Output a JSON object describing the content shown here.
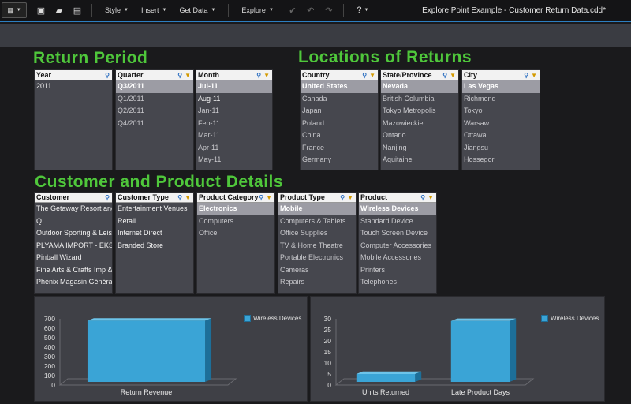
{
  "toolbar": {
    "menus": [
      "Style",
      "Insert",
      "Get Data",
      "Explore"
    ],
    "title": "Explore Point Example - Customer Return Data.cdd*"
  },
  "sections": {
    "return_period": "Return Period",
    "locations": "Locations of Returns",
    "details": "Customer and Product Details"
  },
  "listboxes": {
    "year": {
      "title": "Year",
      "items": [
        "2011"
      ]
    },
    "quarter": {
      "title": "Quarter",
      "items": [
        "Q3/2011",
        "Q1/2011",
        "Q2/2011",
        "Q4/2011"
      ]
    },
    "month": {
      "title": "Month",
      "items": [
        "Jul-11",
        "Aug-11",
        "Jan-11",
        "Feb-11",
        "Mar-11",
        "Apr-11",
        "May-11"
      ]
    },
    "country": {
      "title": "Country",
      "items": [
        "United States",
        "Canada",
        "Japan",
        "Poland",
        "China",
        "France",
        "Germany"
      ]
    },
    "state": {
      "title": "State/Province",
      "items": [
        "Nevada",
        "British Columbia",
        "Tokyo Metropolis",
        "Mazowieckie",
        "Ontario",
        "Nanjing",
        "Aquitaine"
      ]
    },
    "city": {
      "title": "City",
      "items": [
        "Las Vegas",
        "Richmond",
        "Tokyo",
        "Warsaw",
        "Ottawa",
        "Jiangsu",
        "Hossegor"
      ]
    },
    "customer": {
      "title": "Customer",
      "items": [
        "The Getaway Resort and",
        "Q",
        "Outdoor Sporting & Leis",
        "PLYAMA IMPORT - EKSP",
        "Pinball Wizard",
        "Fine Arts & Crafts Imp &",
        "Phénix Magasin Général"
      ]
    },
    "customer_type": {
      "title": "Customer Type",
      "items": [
        "Entertainment Venues",
        "Retail",
        "Internet Direct",
        "Branded Store"
      ]
    },
    "product_category": {
      "title": "Product Category",
      "items": [
        "Electronics",
        "Computers",
        "Office"
      ]
    },
    "product_type": {
      "title": "Product Type",
      "items": [
        "Mobile",
        "Computers & Tablets",
        "Office Supplies",
        "TV & Home Theatre",
        "Portable Electronics",
        "Cameras",
        "Repairs"
      ]
    },
    "product": {
      "title": "Product",
      "items": [
        "Wireless Devices",
        "Standard Device",
        "Touch Screen Device",
        "Computer Accessories",
        "Mobile Accessories",
        "Printers",
        "Telephones"
      ]
    }
  },
  "chart_data": [
    {
      "type": "bar",
      "categories": [
        "Return Revenue"
      ],
      "series": [
        {
          "name": "Wireless Devices",
          "values": [
            680
          ]
        }
      ],
      "ylim": [
        0,
        700
      ],
      "yticks": [
        0,
        100,
        200,
        300,
        400,
        500,
        600,
        700
      ],
      "legend": "top-right",
      "color": "#3aa4d6"
    },
    {
      "type": "bar",
      "categories": [
        "Units Returned",
        "Late Product Days"
      ],
      "series": [
        {
          "name": "Wireless Devices",
          "values": [
            5,
            29
          ]
        }
      ],
      "ylim": [
        0,
        30
      ],
      "yticks": [
        0,
        5,
        10,
        15,
        20,
        25,
        30
      ],
      "legend": "top-right",
      "color": "#3aa4d6"
    }
  ]
}
